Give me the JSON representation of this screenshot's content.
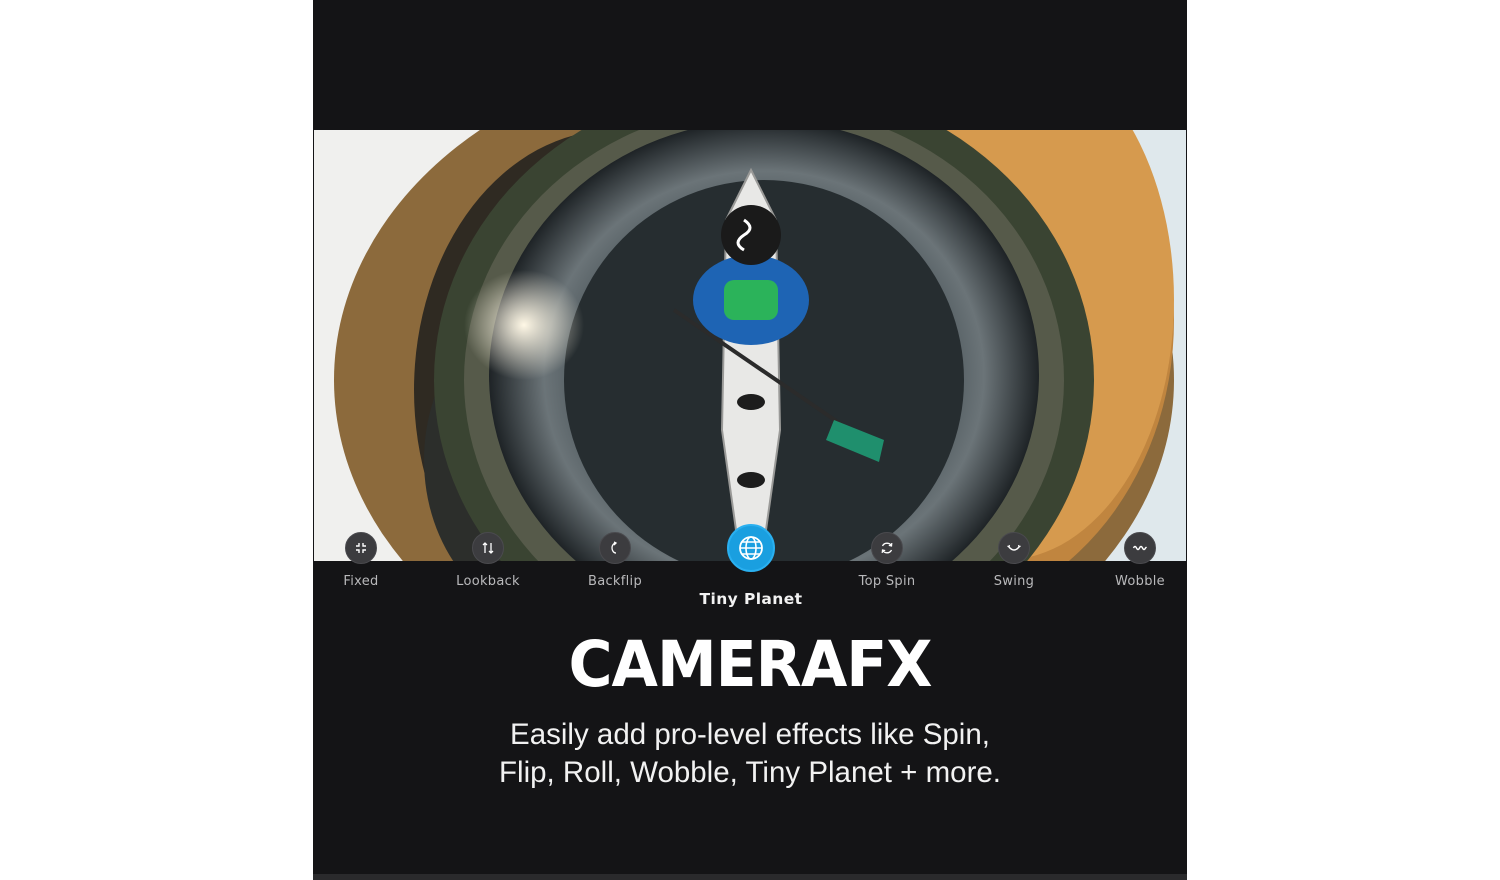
{
  "hero": {
    "image_alt_icon": "tiny-planet-kayaker-photo"
  },
  "effects": {
    "active": "Tiny Planet",
    "items": [
      {
        "label": "Fixed",
        "icon": "fixed-icon"
      },
      {
        "label": "Lookback",
        "icon": "lookback-icon"
      },
      {
        "label": "Backflip",
        "icon": "backflip-icon"
      },
      {
        "label": "Tiny Planet",
        "icon": "globe-icon"
      },
      {
        "label": "Top Spin",
        "icon": "spin-icon"
      },
      {
        "label": "Swing",
        "icon": "swing-icon"
      },
      {
        "label": "Wobble",
        "icon": "wobble-icon"
      }
    ]
  },
  "feature": {
    "title": "CAMERAFX",
    "subtitle_line1": "Easily add pro-level effects like Spin,",
    "subtitle_line2": "Flip, Roll, Wobble, Tiny Planet + more."
  },
  "colors": {
    "panel_bg": "#141416",
    "accent": "#1a9fe0",
    "page_bg": "#ffffff"
  }
}
